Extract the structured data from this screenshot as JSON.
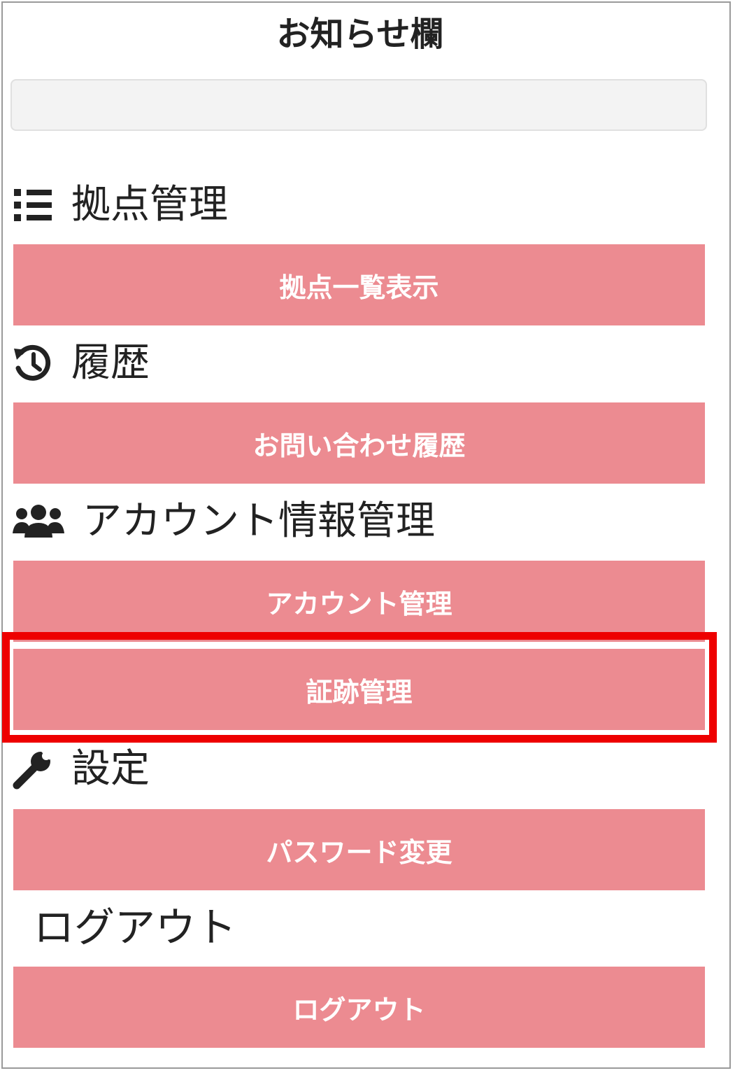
{
  "notice": {
    "title": "お知らせ欄",
    "content": ""
  },
  "sections": {
    "sites": {
      "icon": "list-icon",
      "label": "拠点管理",
      "buttons": [
        "拠点一覧表示"
      ]
    },
    "history": {
      "icon": "history-icon",
      "label": "履歴",
      "buttons": [
        "お問い合わせ履歴"
      ]
    },
    "account": {
      "icon": "users-icon",
      "label": "アカウント情報管理",
      "buttons": [
        "アカウント管理",
        "証跡管理"
      ]
    },
    "settings": {
      "icon": "wrench-icon",
      "label": "設定",
      "buttons": [
        "パスワード変更"
      ]
    },
    "logout": {
      "label": "ログアウト",
      "buttons": [
        "ログアウト"
      ]
    }
  },
  "colors": {
    "button": "#ec8b91",
    "highlight": "#ee0000"
  }
}
